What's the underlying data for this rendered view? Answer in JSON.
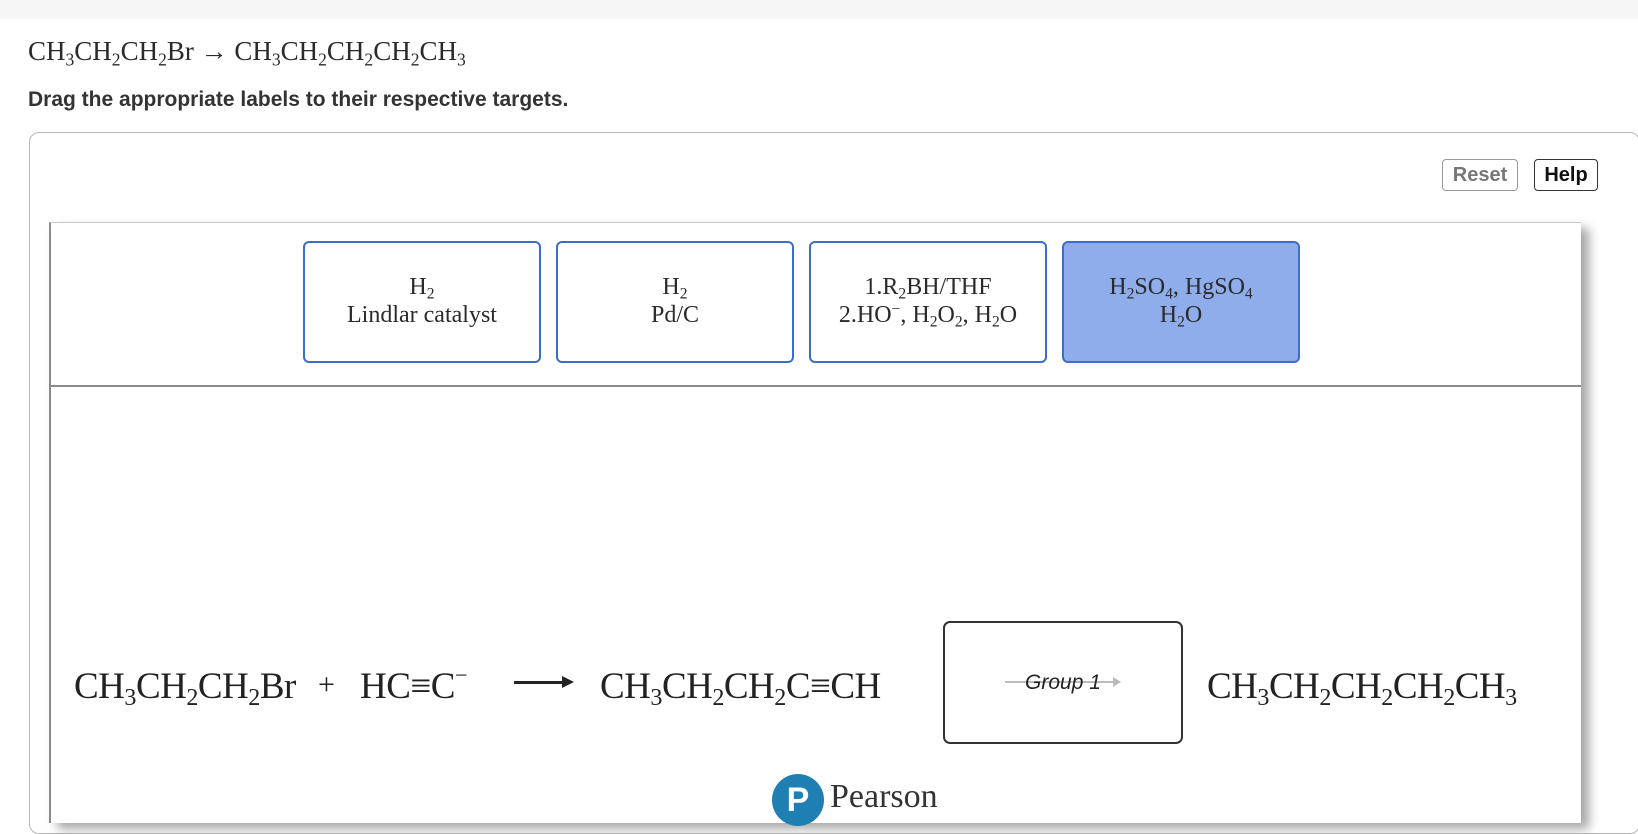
{
  "question": {
    "equation": {
      "reactant": [
        "CH",
        "3",
        "CH",
        "2",
        "CH",
        "2",
        "Br"
      ],
      "arrow": "→",
      "product": [
        "CH",
        "3",
        "CH",
        "2",
        "CH",
        "2",
        "CH",
        "2",
        "CH",
        "3"
      ]
    },
    "instruction": "Drag the appropriate labels to their respective targets."
  },
  "toolbar": {
    "reset_label": "Reset",
    "help_label": "Help"
  },
  "labels": [
    {
      "l1": "H",
      "l1s": "2",
      "line2": "Lindlar catalyst"
    },
    {
      "l1": "H",
      "l1s": "2",
      "line2": "Pd/C"
    },
    {
      "a": "1.R",
      "as": "2",
      "b": "BH/THF",
      "c": "2.HO",
      "csup": "−",
      "d": ", H",
      "ds": "2",
      "e": "O",
      "es": "2",
      "f": ", H",
      "fs": "2",
      "g": "O"
    },
    {
      "a": "H",
      "as": "2",
      "b": "SO",
      "bs": "4",
      "c": ", HgSO",
      "cs": "4",
      "d": "H",
      "ds": "2",
      "e": "O",
      "selected": true
    }
  ],
  "scheme": {
    "reactant1": [
      "CH",
      "3",
      "CH",
      "2",
      "CH",
      "2",
      "Br"
    ],
    "plus": "+",
    "reactant2": "HC≡C",
    "reactant2_charge": "−",
    "intermediate": [
      "CH",
      "3",
      "CH",
      "2",
      "CH",
      "2",
      "C≡CH"
    ],
    "target_label": "Group 1",
    "product": [
      "CH",
      "3",
      "CH",
      "2",
      "CH",
      "2",
      "CH",
      "2",
      "CH",
      "3"
    ]
  },
  "footer": {
    "logo_letter": "P",
    "brand": "Pearson"
  },
  "colors": {
    "selected_label_bg": "#90adeb",
    "label_border": "#3a6ec8",
    "logo": "#1f7fb3"
  }
}
